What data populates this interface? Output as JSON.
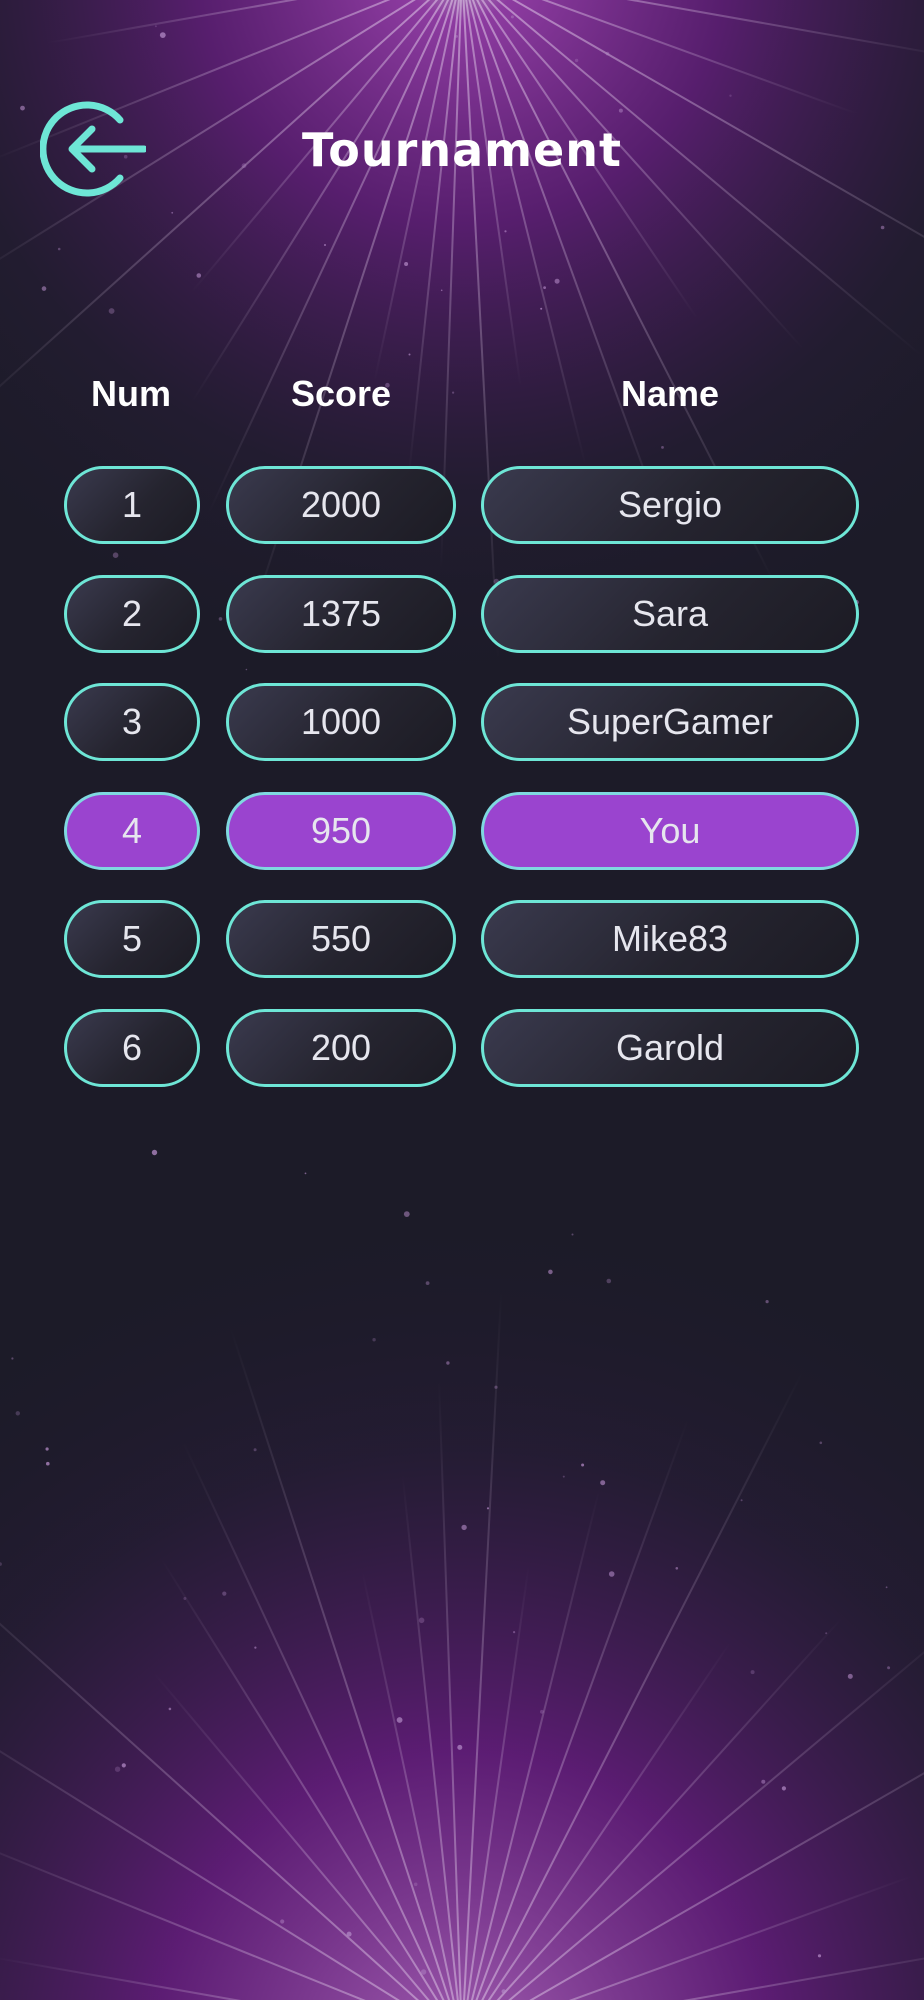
{
  "screen": {
    "title": "Tournament",
    "back_icon": "back-arrow-circle-icon"
  },
  "colors": {
    "accent": "#6ee6d6",
    "highlight": "#9a44cf",
    "background": "#1c1b28",
    "glow": "#7a1f8f"
  },
  "table": {
    "headers": {
      "num": "Num",
      "score": "Score",
      "name": "Name"
    },
    "rows": [
      {
        "num": "1",
        "score": "2000",
        "name": "Sergio",
        "highlight": false
      },
      {
        "num": "2",
        "score": "1375",
        "name": "Sara",
        "highlight": false
      },
      {
        "num": "3",
        "score": "1000",
        "name": "SuperGamer",
        "highlight": false
      },
      {
        "num": "4",
        "score": "950",
        "name": "You",
        "highlight": true
      },
      {
        "num": "5",
        "score": "550",
        "name": "Mike83",
        "highlight": false
      },
      {
        "num": "6",
        "score": "200",
        "name": "Garold",
        "highlight": false
      }
    ]
  }
}
